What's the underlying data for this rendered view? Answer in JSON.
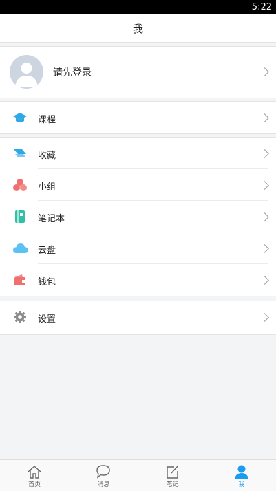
{
  "status": {
    "time": "5:22"
  },
  "header": {
    "title": "我"
  },
  "profile": {
    "login_prompt": "请先登录"
  },
  "course": {
    "label": "课程",
    "icon": "graduation-cap-icon",
    "color": "#2fa8e8"
  },
  "menu": [
    {
      "label": "收藏",
      "icon": "bookmark-icon",
      "color": "#2fa8e8"
    },
    {
      "label": "小组",
      "icon": "group-icon",
      "color": "#f07070"
    },
    {
      "label": "笔记本",
      "icon": "notebook-icon",
      "color": "#2fc1a6"
    },
    {
      "label": "云盘",
      "icon": "cloud-icon",
      "color": "#5cc2f2"
    },
    {
      "label": "钱包",
      "icon": "wallet-icon",
      "color": "#f07070"
    }
  ],
  "settings": {
    "label": "设置",
    "icon": "gear-icon",
    "color": "#8c8c8c"
  },
  "tabs": [
    {
      "label": "首页",
      "icon": "home-icon"
    },
    {
      "label": "消息",
      "icon": "chat-icon"
    },
    {
      "label": "笔记",
      "icon": "edit-note-icon"
    },
    {
      "label": "我",
      "icon": "person-icon",
      "active": true
    }
  ],
  "colors": {
    "accent": "#1a9cf0",
    "background": "#f3f4f6"
  }
}
